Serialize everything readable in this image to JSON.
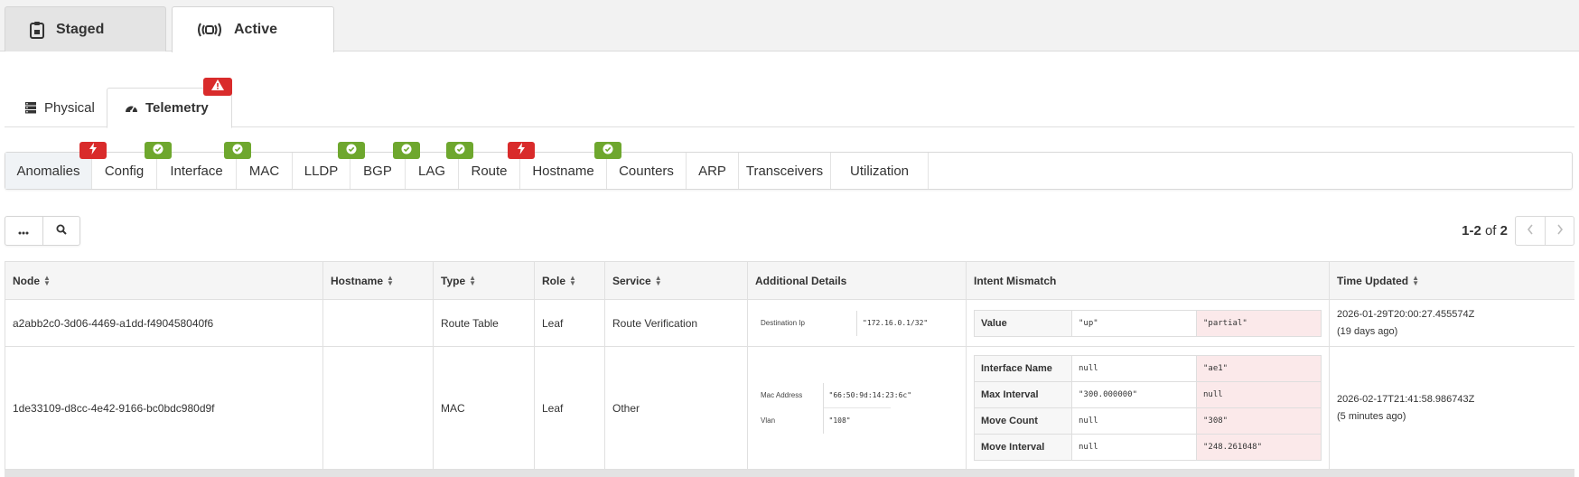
{
  "top_tabs": [
    {
      "label": "Staged",
      "icon": "clipboard-icon"
    },
    {
      "label": "Active",
      "icon": "broadcast-icon"
    }
  ],
  "sub_tabs": [
    {
      "label": "Physical",
      "icon": "server-stack-icon"
    },
    {
      "label": "Telemetry",
      "icon": "speedometer-icon",
      "badge": "warning"
    }
  ],
  "anomaly_tabs": [
    {
      "label": "Anomalies",
      "status": "error",
      "selected": true
    },
    {
      "label": "Config",
      "status": "ok"
    },
    {
      "label": "Interface",
      "status": "ok"
    },
    {
      "label": "MAC",
      "status": null
    },
    {
      "label": "LLDP",
      "status": "ok"
    },
    {
      "label": "BGP",
      "status": "ok"
    },
    {
      "label": "LAG",
      "status": "ok"
    },
    {
      "label": "Route",
      "status": "error"
    },
    {
      "label": "Hostname",
      "status": "ok"
    },
    {
      "label": "Counters",
      "status": null
    },
    {
      "label": "ARP",
      "status": null
    },
    {
      "label": "Transceivers",
      "status": null
    },
    {
      "label": "Utilization",
      "status": null
    }
  ],
  "toolbar": {
    "more_icon": "ellipsis-icon",
    "search_icon": "search-icon"
  },
  "pager": {
    "range": "1-2",
    "of": "of",
    "total": "2"
  },
  "table": {
    "headers": {
      "node": "Node",
      "hostname": "Hostname",
      "type": "Type",
      "role": "Role",
      "service": "Service",
      "additional_details": "Additional Details",
      "intent_mismatch": "Intent Mismatch",
      "time_updated": "Time Updated"
    },
    "rows": [
      {
        "node": "a2abb2c0-3d06-4469-a1dd-f490458040f6",
        "hostname": "",
        "type": "Route Table",
        "role": "Leaf",
        "service": "Route Verification",
        "details": [
          {
            "key": "Destination Ip",
            "value": "\"172.16.0.1/32\""
          }
        ],
        "mismatch": [
          {
            "key": "Value",
            "expected": "\"up\"",
            "actual": "\"partial\""
          }
        ],
        "time": "2026-01-29T20:00:27.455574Z",
        "time_ago": "(19 days ago)"
      },
      {
        "node": "1de33109-d8cc-4e42-9166-bc0bdc980d9f",
        "hostname": "",
        "type": "MAC",
        "role": "Leaf",
        "service": "Other",
        "details": [
          {
            "key": "Mac Address",
            "value": "\"66:50:9d:14:23:6c\""
          },
          {
            "key": "Vlan",
            "value": "\"108\""
          }
        ],
        "mismatch": [
          {
            "key": "Interface Name",
            "expected": "null",
            "actual": "\"ae1\""
          },
          {
            "key": "Max Interval",
            "expected": "\"300.000000\"",
            "actual": "null"
          },
          {
            "key": "Move Count",
            "expected": "null",
            "actual": "\"308\""
          },
          {
            "key": "Move Interval",
            "expected": "null",
            "actual": "\"248.261048\""
          }
        ],
        "time": "2026-02-17T21:41:58.986743Z",
        "time_ago": "(5 minutes ago)"
      }
    ]
  },
  "colors": {
    "ok": "#6ea72e",
    "error": "#d92b2b"
  }
}
